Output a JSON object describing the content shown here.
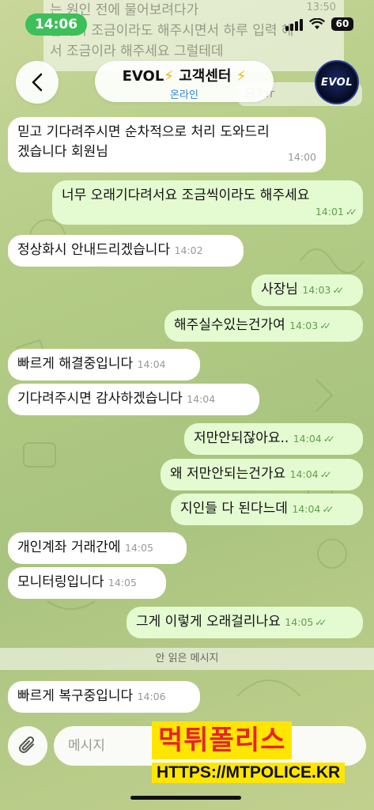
{
  "status_bar": {
    "time": "14:06",
    "battery": "60"
  },
  "background_messages": {
    "line1": "는 원인 전에 물어보려다가",
    "line2": "불락히 조금이라도 해주시면서 하루 입력 해",
    "line3": "서 조금이라 해주세요 그럴테데",
    "time": "13:50",
    "partial": "요?ㅠ"
  },
  "header": {
    "title": "EVOL",
    "title_suffix": "고객센터",
    "bolt": "⚡",
    "status": "온라인",
    "avatar_text": "EVOL"
  },
  "messages": [
    {
      "dir": "in",
      "text_line1": "믿고 기다려주시면 순차적으로 처리 도와드리",
      "text_line2": "겠습니다 회원님",
      "time": "14:00"
    },
    {
      "dir": "out",
      "text": "너무 오래기다려서요 조금씩이라도 해주세요",
      "time": "14:01"
    },
    {
      "dir": "in",
      "text": "정상화시 안내드리겠습니다",
      "time": "14:02"
    },
    {
      "dir": "out",
      "text": "사장님",
      "time": "14:03"
    },
    {
      "dir": "out",
      "text": "해주실수있는건가여",
      "time": "14:03"
    },
    {
      "dir": "in",
      "text": "빠르게 해결중입니다",
      "time": "14:04"
    },
    {
      "dir": "in",
      "text": "기다려주시면 감사하겠습니다",
      "time": "14:04"
    },
    {
      "dir": "out",
      "text": "저만안되잖아요..",
      "time": "14:04"
    },
    {
      "dir": "out",
      "text": "왜 저만안되는건가요",
      "time": "14:04"
    },
    {
      "dir": "out",
      "text": "지인들 다 된다느데",
      "time": "14:04"
    },
    {
      "dir": "in",
      "text": "개인계좌 거래간에",
      "time": "14:05"
    },
    {
      "dir": "in",
      "text": "모니터링입니다",
      "time": "14:05"
    },
    {
      "dir": "out",
      "text": "그게 이렇게 오래걸리나요",
      "time": "14:05"
    },
    {
      "dir": "in",
      "text": "빠르게 복구중입니다",
      "time": "14:06"
    }
  ],
  "unread_divider": "안 읽은 메시지",
  "composer": {
    "placeholder": "메시지"
  },
  "watermark": {
    "title": "먹튀폴리스",
    "url": "HTTPS://MTPOLICE.KR"
  },
  "colors": {
    "incoming": "#ffffff",
    "outgoing": "#e4fbd1",
    "check": "#5da04d",
    "status_pill": "#3dbf59",
    "accent_blue": "#2f83d6"
  }
}
